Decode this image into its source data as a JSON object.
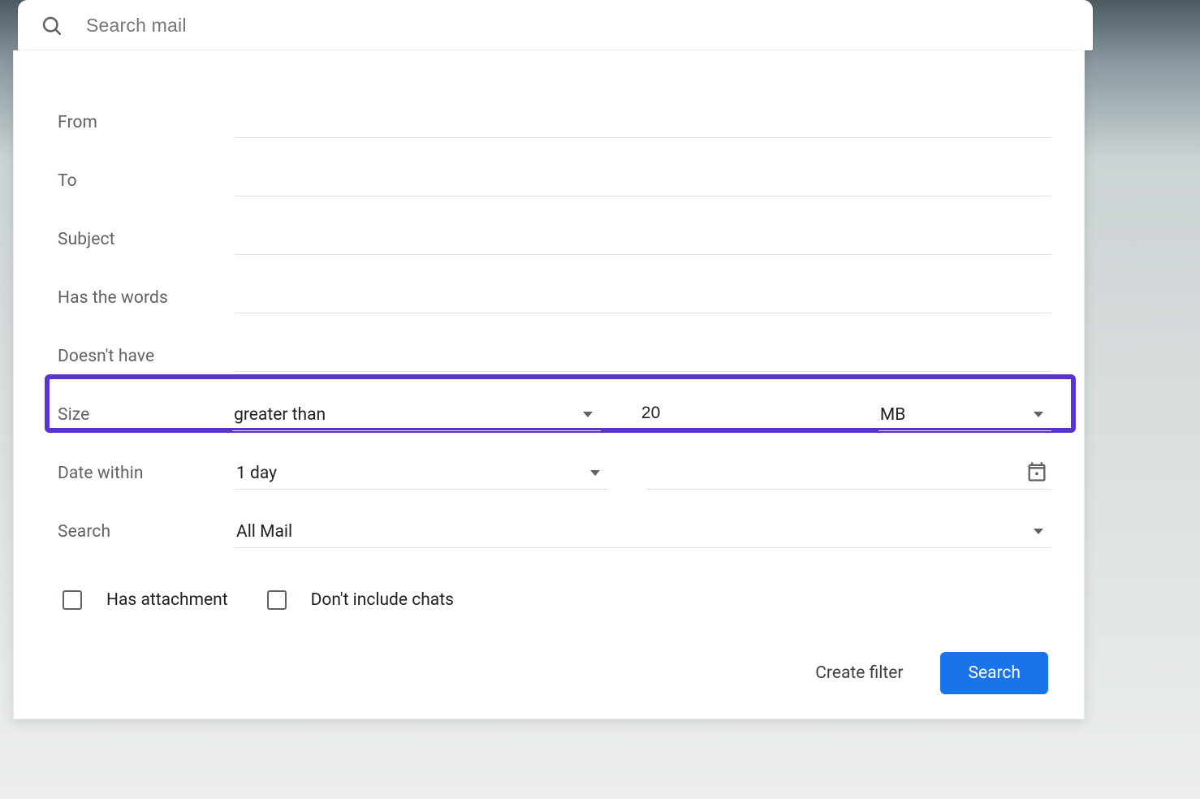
{
  "search": {
    "placeholder": "Search mail",
    "value": ""
  },
  "filter": {
    "from": {
      "label": "From",
      "value": ""
    },
    "to": {
      "label": "To",
      "value": ""
    },
    "subject": {
      "label": "Subject",
      "value": ""
    },
    "has_words": {
      "label": "Has the words",
      "value": ""
    },
    "doesnt_have": {
      "label": "Doesn't have",
      "value": ""
    },
    "size": {
      "label": "Size",
      "comparator": "greater than",
      "value": "20",
      "unit": "MB"
    },
    "date_within": {
      "label": "Date within",
      "range": "1 day",
      "date": ""
    },
    "search_in": {
      "label": "Search",
      "folder": "All Mail"
    },
    "has_attachment": {
      "label": "Has attachment",
      "checked": false
    },
    "exclude_chats": {
      "label": "Don't include chats",
      "checked": false
    }
  },
  "buttons": {
    "create_filter": "Create filter",
    "search": "Search"
  },
  "colors": {
    "accent": "#1a73e8",
    "highlight_border": "#5a32d1",
    "label_text": "#5f6368"
  }
}
